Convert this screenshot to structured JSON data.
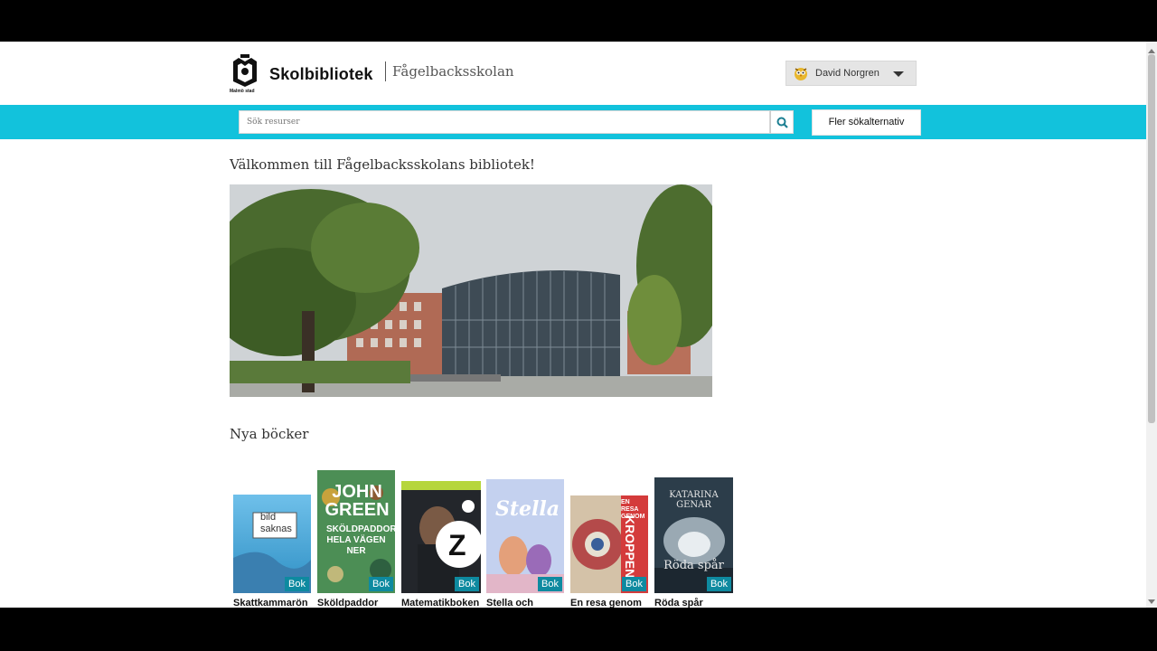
{
  "header": {
    "logo_text": "Malmö stad",
    "brand": "Skolbibliotek",
    "school": "Fågelbacksskolan",
    "user_name": "David Norgren"
  },
  "search": {
    "placeholder": "Sök resurser",
    "more_options_label": "Fler sökalternativ"
  },
  "main": {
    "welcome": "Välkommen till Fågelbacksskolans bibliotek!",
    "new_books_heading": "Nya böcker",
    "books": [
      {
        "title": "Skattkammarön",
        "type": "Bok",
        "cover_text_1": "bild",
        "cover_text_2": "saknas"
      },
      {
        "title": "Sköldpaddor",
        "type": "Bok",
        "cover_text_1": "JOHN GREEN",
        "cover_text_2": "SKÖLDPADDOR HELA VÄGEN NER"
      },
      {
        "title": "Matematikboken",
        "type": "Bok",
        "cover_text_1": "Z"
      },
      {
        "title": "Stella och",
        "type": "Bok",
        "cover_text_1": "Stella"
      },
      {
        "title": "En resa genom",
        "type": "Bok",
        "cover_text_1": "EN RESA GENOM",
        "cover_text_2": "KROPPEN"
      },
      {
        "title": "Röda spår",
        "type": "Bok",
        "cover_text_1": "KATARINA GENAR",
        "cover_text_2": "Röda spår"
      }
    ]
  },
  "colors": {
    "accent": "#12c2dc",
    "badge": "#0e8aa0"
  }
}
